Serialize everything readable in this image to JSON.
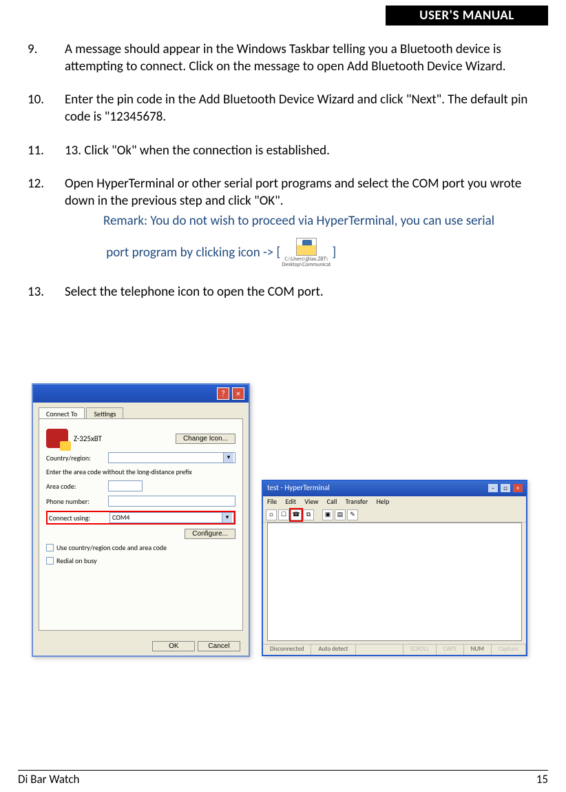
{
  "header": {
    "title": "USER'S MANUAL"
  },
  "items": [
    {
      "num": "9.",
      "text": "A message should appear in the Windows Taskbar telling you a Bluetooth device is attempting to connect. Click on the message to open Add Bluetooth Device Wizard."
    },
    {
      "num": "10.",
      "text": "Enter the pin code in the Add Bluetooth Device Wizard and click \"Next\". The default pin code is \"12345678."
    },
    {
      "num": "11.",
      "text": "13. Click \"Ok\" when the connection is established."
    },
    {
      "num": "12.",
      "text": "Open HyperTerminal or other serial port programs and select the COM port you wrote down in the previous step and click \"OK\"."
    },
    {
      "num": "13.",
      "text": "Select the telephone icon to open the COM port."
    }
  ],
  "remark": {
    "line1": "Remark: You do not wish to proceed via HyperTerminal, you can use serial",
    "line2a": "port program by clicking icon -> [",
    "line2b": "]",
    "iconPath1": "C:\\Users\\jjliao.ZBT\\",
    "iconPath2": "Desktop\\Communicat"
  },
  "dlg1": {
    "tab1": "Connect To",
    "tab2": "Settings",
    "device": "Z-325xBT",
    "changeIcon": "Change Icon...",
    "countryLabel": "Country/region:",
    "areaHint": "Enter the area code without the long-distance prefix",
    "areaLabel": "Area code:",
    "phoneLabel": "Phone number:",
    "connectLabel": "Connect using:",
    "connectVal": "COM4",
    "configure": "Configure...",
    "chk1": "Use country/region code and area code",
    "chk2": "Redial on busy",
    "ok": "OK",
    "cancel": "Cancel",
    "help": "?",
    "close": "×"
  },
  "ht": {
    "title": "test - HyperTerminal",
    "menu": {
      "file": "File",
      "edit": "Edit",
      "view": "View",
      "call": "Call",
      "transfer": "Transfer",
      "help": "Help"
    },
    "status": {
      "s1": "Disconnected",
      "s2": "Auto detect",
      "s3": "SCROLL",
      "s4": "CAPS",
      "s5": "NUM",
      "s6": "Capture"
    },
    "min": "–",
    "max": "□",
    "close": "×"
  },
  "footer": {
    "left": "Di Bar Watch",
    "page": "15"
  }
}
